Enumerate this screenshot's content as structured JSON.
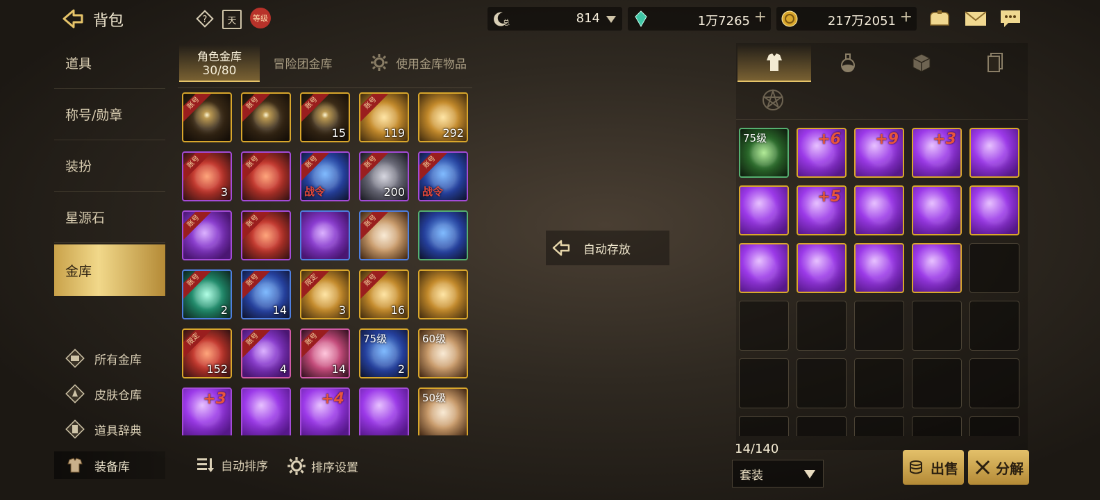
{
  "header": {
    "title": "背包",
    "icons": [
      "help-icon",
      "calendar-icon",
      "level-badge-icon"
    ],
    "calendar_label": "天",
    "level_label": "等级",
    "currencies": [
      {
        "name": "fatigue",
        "value": "814",
        "icon": "fatigue-icon",
        "sub": "总"
      },
      {
        "name": "crystal",
        "value": "1万7265",
        "icon": "crystal-icon"
      },
      {
        "name": "gold",
        "value": "217万2051",
        "icon": "gold-coin-icon"
      }
    ],
    "right_icons": [
      "wallet-icon",
      "mail-icon",
      "chat-icon"
    ]
  },
  "sidebar": {
    "items": [
      {
        "label": "道具"
      },
      {
        "label": "称号/勋章"
      },
      {
        "label": "装扮"
      },
      {
        "label": "星源石"
      },
      {
        "label": "金库",
        "active": true
      }
    ],
    "sub_items": [
      {
        "label": "所有金库",
        "icon": "all-vault-icon"
      },
      {
        "label": "皮肤仓库",
        "icon": "skin-storage-icon"
      },
      {
        "label": "道具辞典",
        "icon": "item-dictionary-icon"
      },
      {
        "label": "装备库",
        "icon": "equipment-storage-icon"
      }
    ]
  },
  "vault_tabs": {
    "character": {
      "label": "角色金库",
      "count": "30/80"
    },
    "adventure": {
      "label": "冒险团金库"
    },
    "use": {
      "label": "使用金库物品"
    }
  },
  "vault_grid": [
    [
      {
        "art": "dark",
        "border": "gold",
        "ribbon": "账号"
      },
      {
        "art": "dark",
        "border": "gold",
        "ribbon": "账号"
      },
      {
        "art": "dark",
        "border": "gold",
        "ribbon": "账号",
        "count": "15"
      },
      {
        "art": "gold",
        "border": "gold",
        "ribbon": "账号",
        "count": "119"
      },
      {
        "art": "gold",
        "border": "gold",
        "count": "292"
      }
    ],
    [
      {
        "art": "red",
        "border": "purple",
        "ribbon": "账号",
        "count": "3"
      },
      {
        "art": "red",
        "border": "purple",
        "ribbon": "账号"
      },
      {
        "art": "blue",
        "border": "purple",
        "ribbon": "账号",
        "extra": "战令"
      },
      {
        "art": "gray",
        "border": "purple",
        "ribbon": "账号",
        "count": "200"
      },
      {
        "art": "blue",
        "border": "purple",
        "ribbon": "账号",
        "extra": "战令"
      }
    ],
    [
      {
        "art": "purple",
        "border": "purple",
        "ribbon": "账号"
      },
      {
        "art": "red",
        "border": "purple",
        "ribbon": "账号"
      },
      {
        "art": "purple",
        "border": "blue"
      },
      {
        "art": "cream",
        "border": "blue",
        "ribbon": "账号"
      },
      {
        "art": "blue",
        "border": "green"
      }
    ],
    [
      {
        "art": "teal",
        "border": "blue",
        "ribbon": "账号",
        "count": "2"
      },
      {
        "art": "blue",
        "border": "blue",
        "ribbon": "账号",
        "count": "14"
      },
      {
        "art": "gold",
        "border": "gold",
        "ribbon": "限定",
        "count": "3"
      },
      {
        "art": "gold",
        "border": "gold",
        "ribbon": "账号",
        "count": "16"
      },
      {
        "art": "gold",
        "border": "gold"
      }
    ],
    [
      {
        "art": "red",
        "border": "gold",
        "ribbon": "限定",
        "count": "152"
      },
      {
        "art": "purple",
        "border": "pink",
        "ribbon": "账号",
        "count": "4"
      },
      {
        "art": "pink",
        "border": "pink",
        "ribbon": "账号",
        "count": "14"
      },
      {
        "art": "blue",
        "border": "gold",
        "level": "75级",
        "count": "2"
      },
      {
        "art": "cream",
        "border": "gold",
        "level": "60级"
      }
    ],
    [
      {
        "art": "vpurple",
        "border": "purple",
        "plus": "+3"
      },
      {
        "art": "vpurple",
        "border": "purple"
      },
      {
        "art": "vpurple",
        "border": "purple",
        "plus": "+4"
      },
      {
        "art": "vpurple",
        "border": "purple"
      },
      {
        "art": "cream",
        "border": "gold",
        "level": "50级"
      }
    ]
  ],
  "center": {
    "auto_store_label": "自动存放",
    "auto_store_icon": "store-arrow-icon"
  },
  "bottom_left": {
    "auto_sort_label": "自动排序",
    "sort_settings_label": "排序设置"
  },
  "equip_tabs": [
    "armor-tab-icon",
    "potion-tab-icon",
    "cube-tab-icon",
    "card-tab-icon",
    "pentagram-tab-icon"
  ],
  "equip_grid": [
    [
      {
        "art": "green",
        "border": "green",
        "level": "75级"
      },
      {
        "art": "vpurple",
        "border": "gold",
        "plus": "+6"
      },
      {
        "art": "vpurple",
        "border": "gold",
        "plus": "+9"
      },
      {
        "art": "vpurple",
        "border": "gold",
        "plus": "+3"
      },
      {
        "art": "vpurple",
        "border": "gold"
      }
    ],
    [
      {
        "art": "vpurple",
        "border": "gold"
      },
      {
        "art": "vpurple",
        "border": "gold",
        "plus": "+5"
      },
      {
        "art": "vpurple",
        "border": "gold"
      },
      {
        "art": "vpurple",
        "border": "gold"
      },
      {
        "art": "vpurple",
        "border": "gold"
      }
    ],
    [
      {
        "art": "vpurple",
        "border": "gold"
      },
      {
        "art": "vpurple",
        "border": "gold"
      },
      {
        "art": "vpurple",
        "border": "gold"
      },
      {
        "art": "vpurple",
        "border": "gold"
      },
      {
        "empty": true
      }
    ],
    [
      {
        "empty": true
      },
      {
        "empty": true
      },
      {
        "empty": true
      },
      {
        "empty": true
      },
      {
        "empty": true
      }
    ],
    [
      {
        "empty": true
      },
      {
        "empty": true
      },
      {
        "empty": true
      },
      {
        "empty": true
      },
      {
        "empty": true
      }
    ],
    [
      {
        "empty": true
      },
      {
        "empty": true
      },
      {
        "empty": true
      },
      {
        "empty": true
      },
      {
        "empty": true
      }
    ]
  ],
  "equip_footer": {
    "count": "14/140",
    "filter_value": "套装",
    "sell_label": "出售",
    "disassemble_label": "分解"
  }
}
